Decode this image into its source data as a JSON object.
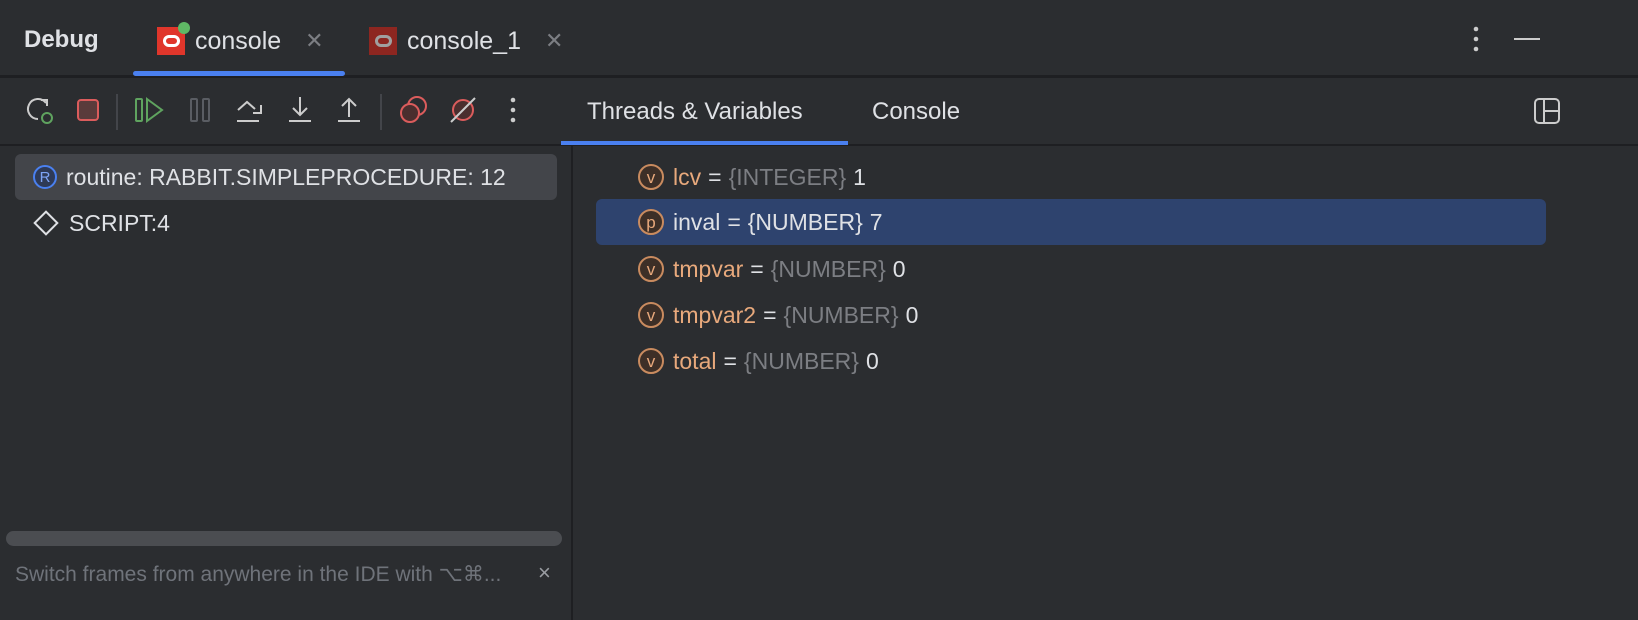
{
  "header": {
    "title": "Debug",
    "tabs": [
      {
        "label": "console",
        "active": true
      },
      {
        "label": "console_1",
        "active": false
      }
    ]
  },
  "toolbar": {
    "buttons": [
      "rerun-debug",
      "stop",
      "resume",
      "pause",
      "step-over",
      "step-into",
      "step-out",
      "view-breakpoints",
      "mute-breakpoints",
      "more"
    ]
  },
  "right_tabs": [
    {
      "label": "Threads & Variables",
      "active": true
    },
    {
      "label": "Console",
      "active": false
    }
  ],
  "frames": [
    {
      "badge": "R",
      "label": "routine: RABBIT.SIMPLEPROCEDURE: 12",
      "selected": true
    },
    {
      "label": "SCRIPT:4",
      "selected": false
    }
  ],
  "variables": [
    {
      "badge": "v",
      "name": "lcv",
      "eq": "=",
      "type": "{INTEGER}",
      "value": "1"
    },
    {
      "badge": "p",
      "name": "inval",
      "eq": "=",
      "type": "{NUMBER}",
      "value": "7"
    },
    {
      "badge": "v",
      "name": "tmpvar",
      "eq": "=",
      "type": "{NUMBER}",
      "value": "0"
    },
    {
      "badge": "v",
      "name": "tmpvar2",
      "eq": "=",
      "type": "{NUMBER}",
      "value": "0"
    },
    {
      "badge": "v",
      "name": "total",
      "eq": "=",
      "type": "{NUMBER}",
      "value": "0"
    }
  ],
  "hint": {
    "text": "Switch frames from anywhere in the IDE with ⌥⌘...",
    "close": "×"
  },
  "colors": {
    "accent": "#4a80f0",
    "selection": "#2e436e",
    "var_name": "#e8a97c"
  }
}
